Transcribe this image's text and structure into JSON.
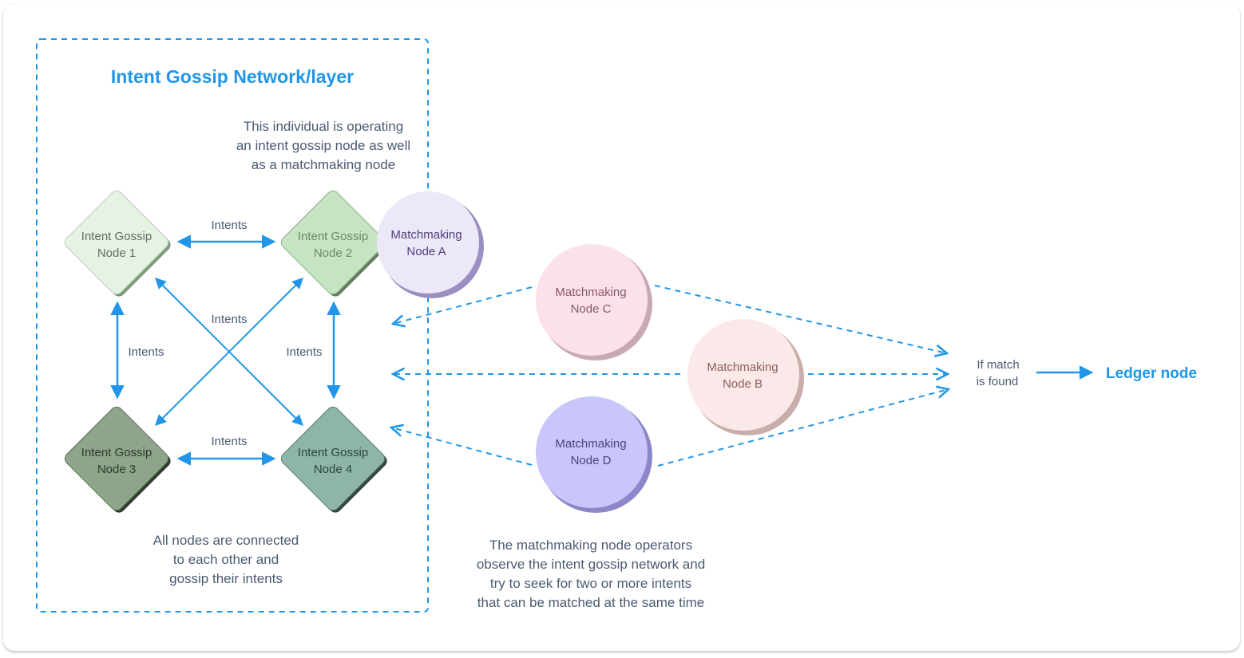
{
  "colors": {
    "accent": "#2196e8",
    "text": "#4a5a72",
    "node1_fill": "#e6f2e4",
    "node2_fill": "#c6e4c4",
    "node3_fill": "#8da589",
    "node4_fill": "#8fb5a7",
    "nodeA_fill": "#ece8f8",
    "nodeB_fill": "#fbe9e9",
    "nodeC_fill": "#fbe1ea",
    "nodeD_fill": "#c9c6fb"
  },
  "network": {
    "title": "Intent Gossip Network/layer",
    "operator_note": [
      "This individual is operating",
      "an intent gossip node as well",
      "as a matchmaking node"
    ],
    "footer_note": [
      "All nodes are connected",
      "to each other and",
      "gossip their intents"
    ],
    "nodes": [
      {
        "id": "node1",
        "lines": [
          "Intent Gossip",
          "Node 1"
        ]
      },
      {
        "id": "node2",
        "lines": [
          "Intent Gossip",
          "Node 2"
        ]
      },
      {
        "id": "node3",
        "lines": [
          "Intent Gossip",
          "Node 3"
        ]
      },
      {
        "id": "node4",
        "lines": [
          "Intent Gossip",
          "Node 4"
        ]
      }
    ],
    "edge_labels": {
      "top": "Intents",
      "bottom": "Intents",
      "left": "Intents",
      "right": "Intents",
      "cross": "Intents"
    }
  },
  "matchmaking": {
    "nodes": [
      {
        "id": "nodeA",
        "lines": [
          "Matchmaking",
          "Node A"
        ]
      },
      {
        "id": "nodeC",
        "lines": [
          "Matchmaking",
          "Node C"
        ]
      },
      {
        "id": "nodeB",
        "lines": [
          "Matchmaking",
          "Node B"
        ]
      },
      {
        "id": "nodeD",
        "lines": [
          "Matchmaking",
          "Node D"
        ]
      }
    ],
    "description": [
      "The matchmaking node operators",
      "observe the intent gossip network and",
      "try to seek for two or more intents",
      "that can be matched at the same time"
    ]
  },
  "outcome": {
    "condition": [
      "If match",
      "is found"
    ],
    "target": "Ledger node"
  }
}
